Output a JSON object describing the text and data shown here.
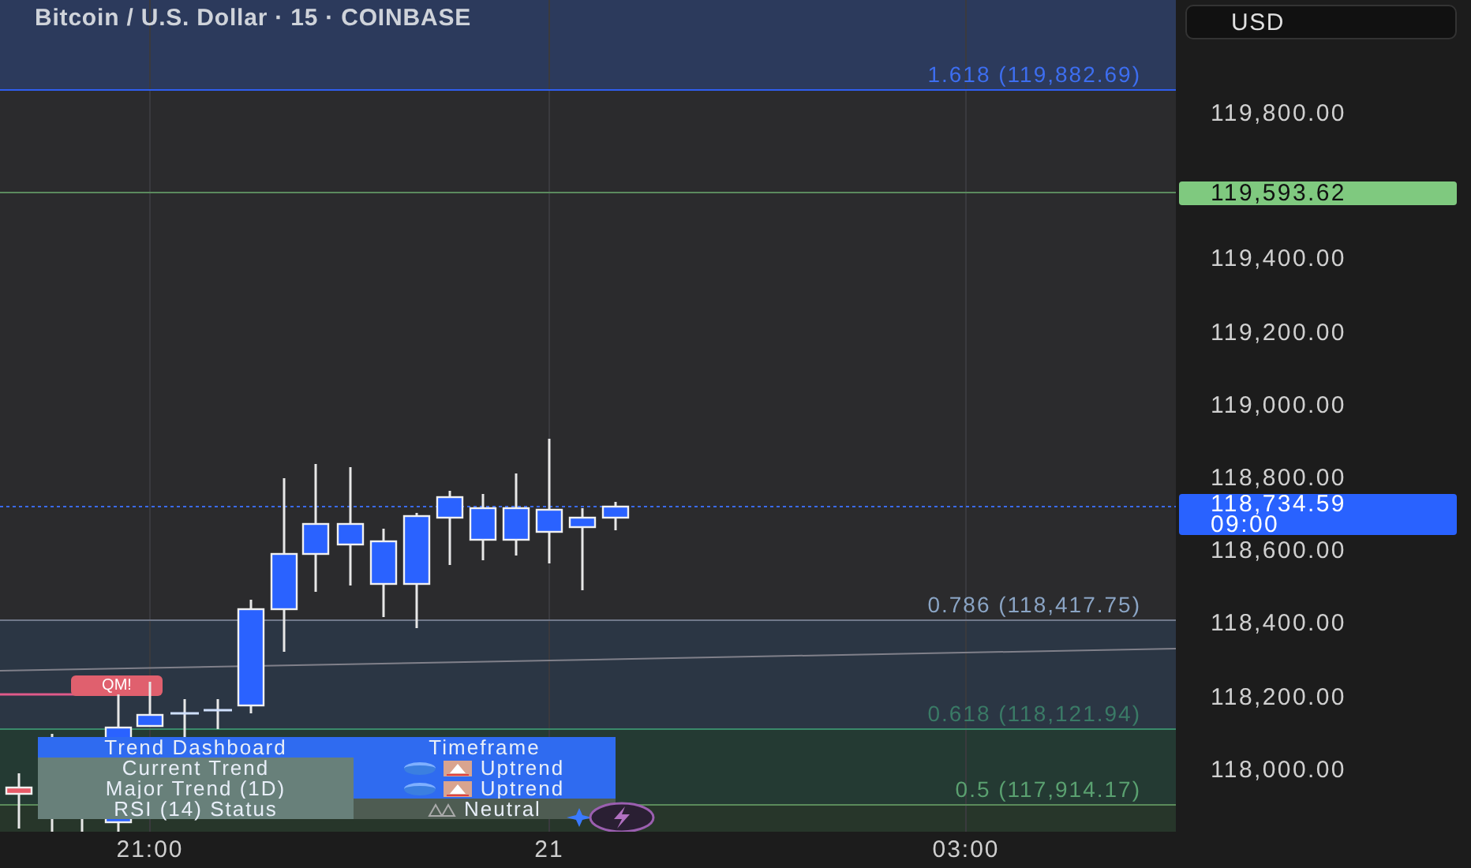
{
  "chart": {
    "title": "Bitcoin / U.S. Dollar · 15 · COINBASE",
    "fib_levels": [
      {
        "label": "1.618 (119,882.69)",
        "kind": "extension"
      },
      {
        "label": "0.786 (118,417.75)",
        "kind": "upper"
      },
      {
        "label": "0.618 (118,121.94)",
        "kind": "middle"
      },
      {
        "label": "0.5 (117,914.17)",
        "kind": "lower"
      }
    ],
    "marker": {
      "label": "QM!"
    },
    "dashboard": {
      "header": [
        "Trend Dashboard",
        "Timeframe"
      ],
      "rows": [
        {
          "label": "Current Trend",
          "status": "Uptrend",
          "kind": "uptrend"
        },
        {
          "label": "Major Trend (1D)",
          "status": "Uptrend",
          "kind": "uptrend"
        },
        {
          "label": "RSI (14) Status",
          "status": "Neutral",
          "kind": "neutral"
        }
      ]
    }
  },
  "price_axis": {
    "currency": "USD",
    "ticks": [
      "119,800.00",
      "119,400.00",
      "119,200.00",
      "119,000.00",
      "118,800.00",
      "118,600.00",
      "118,400.00",
      "118,200.00",
      "118,000.00"
    ],
    "target_price": "119,593.62",
    "current_price": "118,734.59",
    "countdown": "09:00"
  },
  "time_axis": {
    "ticks": [
      "21:00",
      "21",
      "03:00"
    ]
  }
}
